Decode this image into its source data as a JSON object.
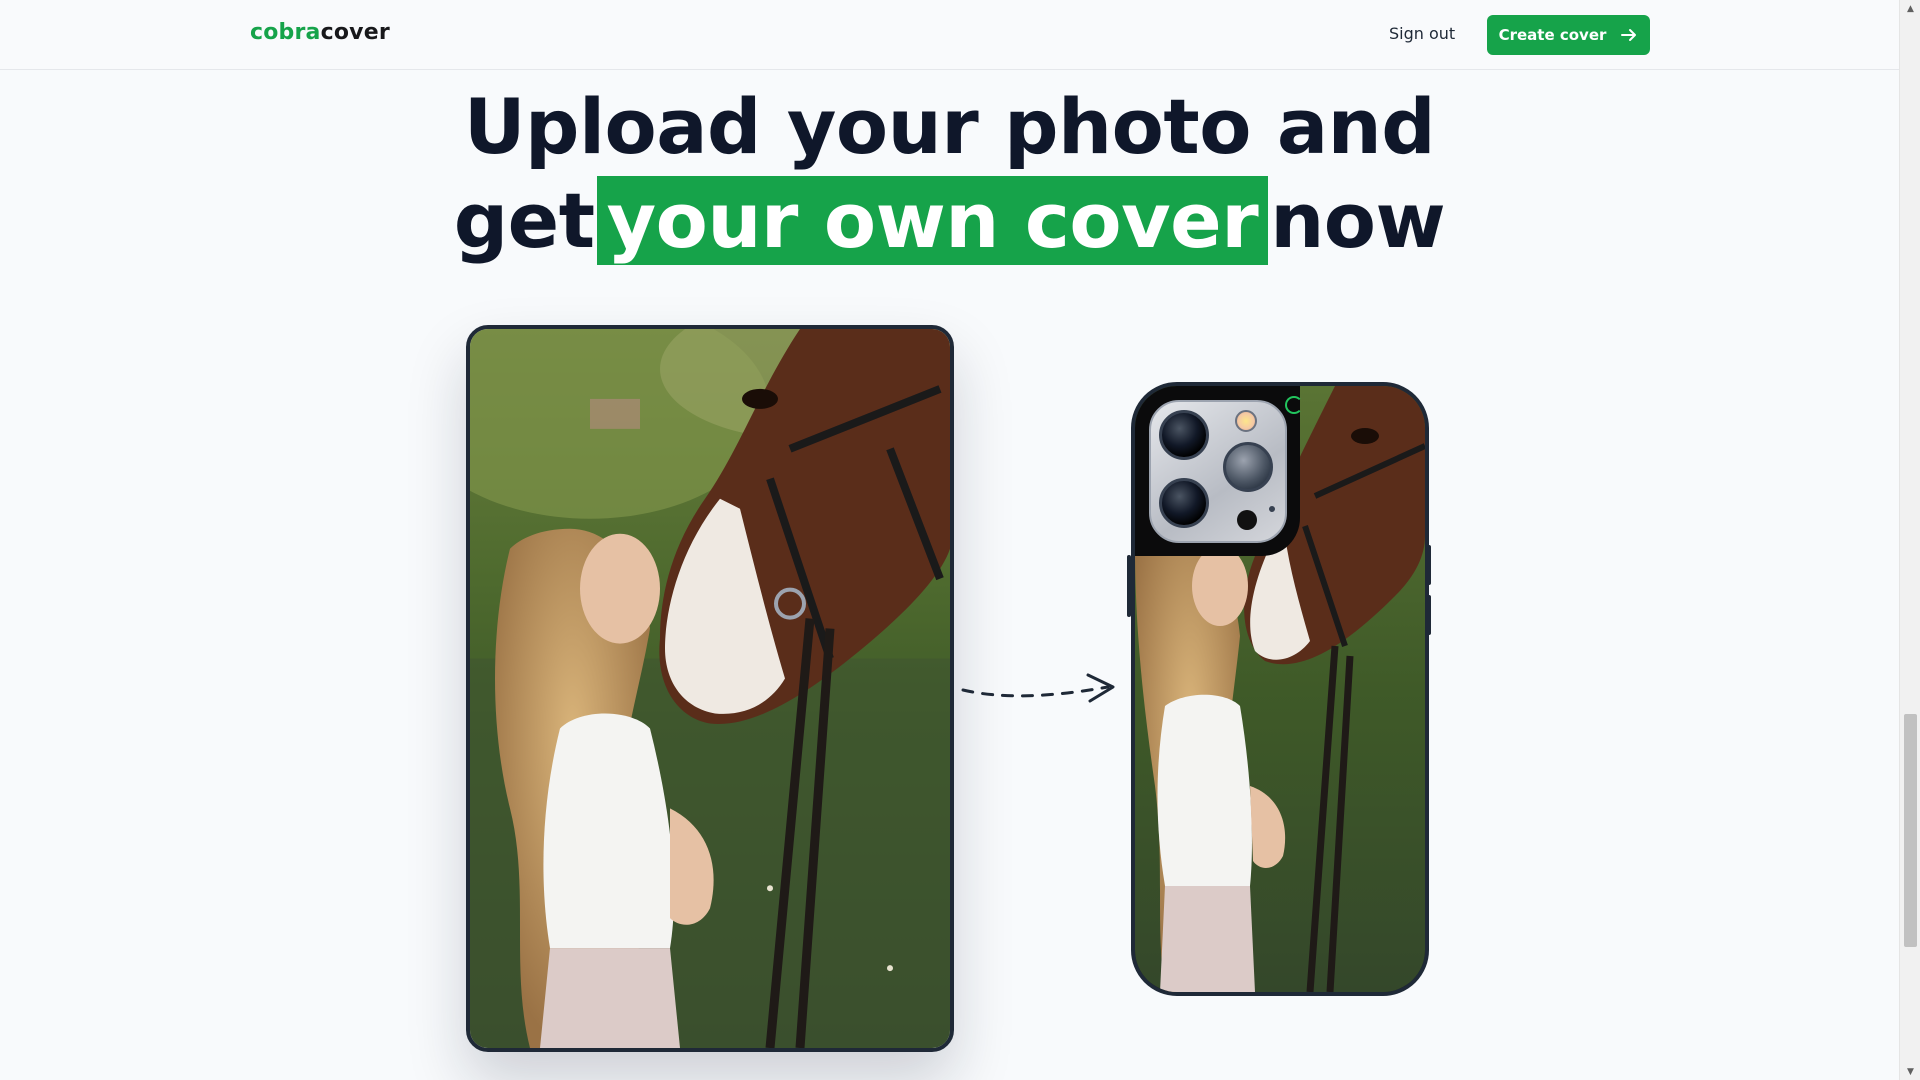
{
  "nav": {
    "logo_brand": "cobra",
    "logo_rest": "cover",
    "signout_label": "Sign out",
    "cta_label": "Create cover",
    "cta_icon": "arrow-right-icon"
  },
  "hero": {
    "line1": "Upload your photo and",
    "line2_before": "get",
    "line2_highlight": "your own cover",
    "line2_after": "now"
  },
  "colors": {
    "accent": "#16a34a",
    "heading": "#0f172a",
    "background": "#f8fafc",
    "frame_border": "#1f2937"
  },
  "showcase": {
    "source_image": "photo-woman-kissing-horse",
    "arrow_icon": "dashed-arrow-icon",
    "result_image": "phone-case-preview"
  }
}
